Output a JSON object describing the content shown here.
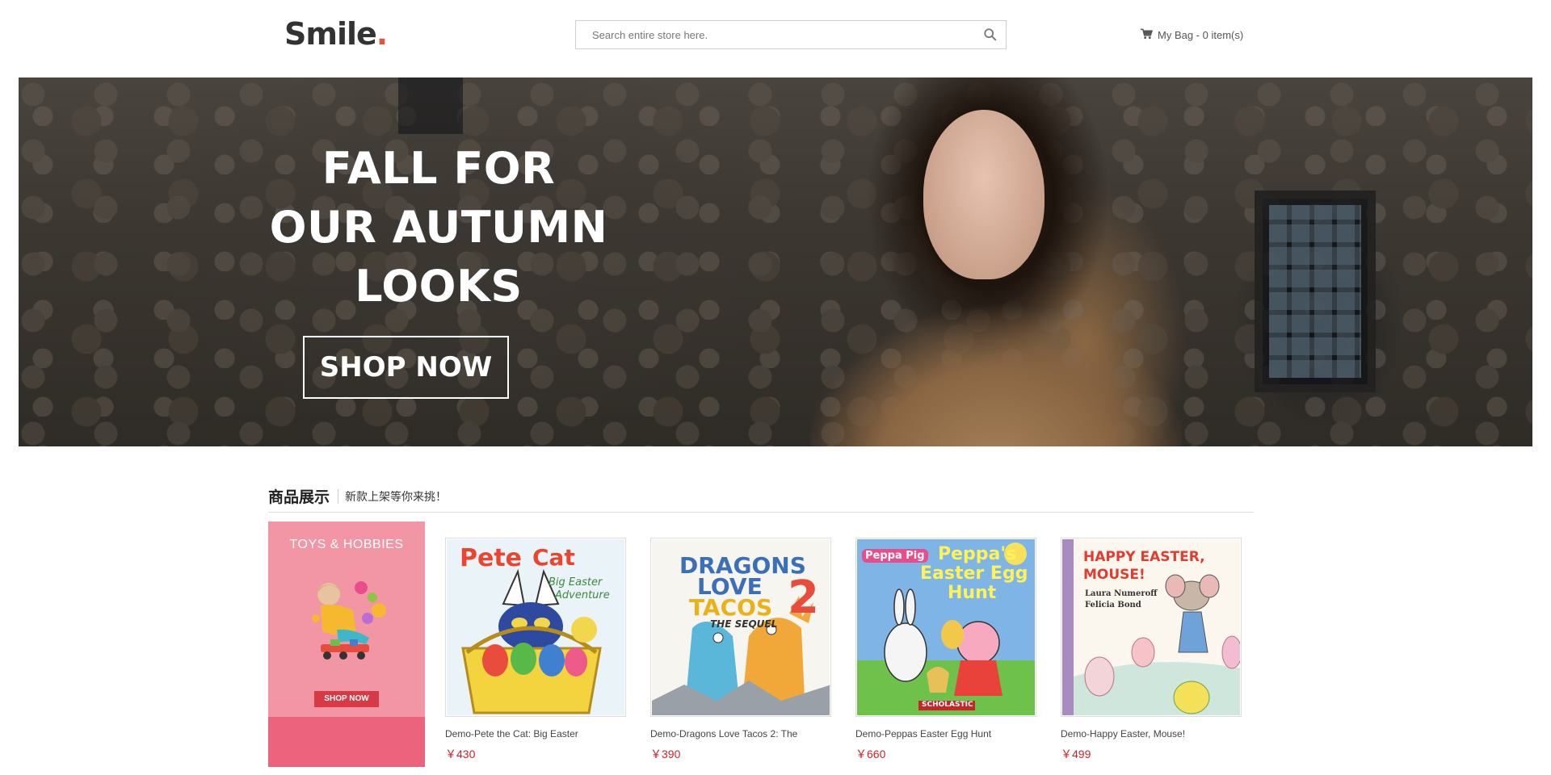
{
  "header": {
    "logo_text": "Smile",
    "logo_dot": ".",
    "search_placeholder": "Search entire store here.",
    "cart_label": "My Bag - 0 item(s)"
  },
  "banner": {
    "line1": "FALL FOR",
    "line2": "OUR AUTUMN",
    "line3": "LOOKS",
    "button_label": "SHOP NOW"
  },
  "section": {
    "title": "商品展示",
    "subtitle": "新款上架等你来挑！"
  },
  "promo": {
    "title": "TOYS & HOBBIES",
    "button_label": "SHOP NOW"
  },
  "products": [
    {
      "name": "Demo-Pete the Cat: Big Easter",
      "price": "￥430",
      "cover": {
        "line1": "Pete",
        "line2": "Cat",
        "line3": "Big Easter",
        "line4": "Adventure"
      }
    },
    {
      "name": "Demo-Dragons Love Tacos 2: The",
      "price": "￥390",
      "cover": {
        "line1": "DRAGONS",
        "line2": "LOVE",
        "line3": "TACOS",
        "num": "2",
        "line4": "THE SEQUEL"
      }
    },
    {
      "name": "Demo-Peppas Easter Egg Hunt",
      "price": "￥660",
      "cover": {
        "badge": "Peppa Pig",
        "line1": "Peppa's",
        "line2": "Easter Egg",
        "line3": "Hunt",
        "publisher": "SCHOLASTIC"
      }
    },
    {
      "name": "Demo-Happy Easter, Mouse!",
      "price": "￥499",
      "cover": {
        "line1": "HAPPY EASTER,",
        "line2": "MOUSE!",
        "author1": "Laura Numeroff",
        "author2": "Felicia Bond"
      }
    }
  ],
  "colors": {
    "accent": "#e2533b",
    "price": "#c8242c",
    "promo_bg": "#f296a5",
    "promo_bottom": "#ec637d",
    "promo_btn": "#d73a44"
  },
  "icons": {
    "search": "search-icon",
    "cart": "cart-icon"
  }
}
